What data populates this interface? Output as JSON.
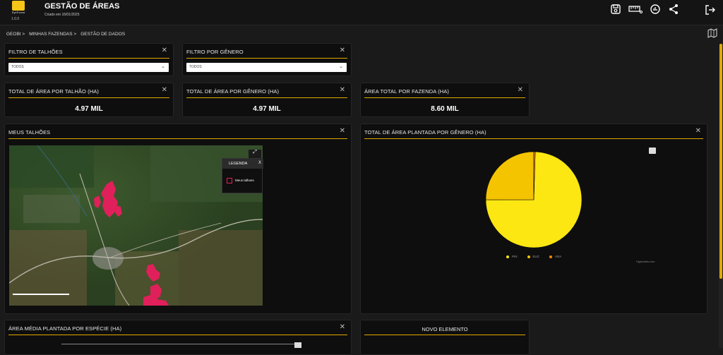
{
  "header": {
    "logo_text": "EyeForest",
    "version": "1.0.0",
    "title": "GESTÃO DE ÁREAS",
    "subtitle": "Criado em 16/01/2025",
    "icons": [
      "save-icon",
      "ruler-icon",
      "chart-icon",
      "share-icon",
      "logout-icon"
    ]
  },
  "breadcrumb": [
    "GEOBI >",
    "MINHAS FAZENDAS >",
    "GESTÃO DE DADOS"
  ],
  "filters": [
    {
      "title": "FILTRO DE TALHÕES",
      "value": "TODOS"
    },
    {
      "title": "FILTRO POR GÊNERO",
      "value": "TODOS"
    }
  ],
  "kpis": [
    {
      "title": "TOTAL DE ÁREA POR TALHÃO (HA)",
      "value": "4.97 MIL"
    },
    {
      "title": "TOTAL DE ÁREA POR GÊNERO (HA)",
      "value": "4.97 MIL"
    },
    {
      "title": "ÁREA TOTAL POR FAZENDA (HA)",
      "value": "8.60 MIL"
    }
  ],
  "map_card": {
    "title": "MEUS TALHÕES",
    "legend_title": "LEGENDA",
    "legend_close": "X",
    "legend_item": "Meus talhoes",
    "expand": "⤢"
  },
  "pie_card": {
    "title": "TOTAL DE ÁREA PLANTADA POR GÊNERO (HA)",
    "credits": "Highcharts.com"
  },
  "chart_data": {
    "type": "pie",
    "categories": [
      "PIN",
      "EUC",
      "ARA"
    ],
    "values": [
      74.5,
      25,
      0.5
    ],
    "colors": [
      "#fce712",
      "#f5c400",
      "#f08a00"
    ],
    "legend": "bottom"
  },
  "bottom_cards": [
    {
      "title": "ÁREA MÉDIA PLANTADA POR ESPÉCIE (HA)"
    },
    {
      "title": "NOVO ELEMENTO"
    }
  ],
  "close_glyph": "✕",
  "accent": "#e0a800"
}
